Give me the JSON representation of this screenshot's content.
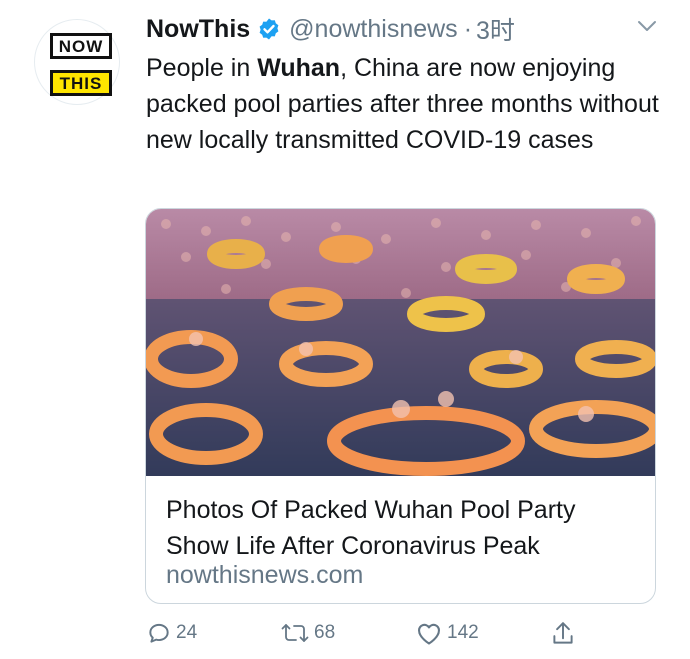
{
  "author": {
    "display_name": "NowThis",
    "handle": "@nowthisnews",
    "separator": "·",
    "time": "3时",
    "logo_top": "NOW",
    "logo_bottom": "THIS"
  },
  "tweet": {
    "text_before": "People in ",
    "text_bold": "Wuhan",
    "text_after": ", China are now enjoying packed pool parties after three months without new locally transmitted COVID-19 cases"
  },
  "card": {
    "title_line1": "Photos Of Packed Wuhan Pool Party",
    "title_line2": "Show Life After Coronavirus Peak",
    "domain": "nowthisnews.com"
  },
  "actions": {
    "reply_count": "24",
    "retweet_count": "68",
    "like_count": "142"
  },
  "colors": {
    "verified": "#1da1f2",
    "secondary_text": "#657786",
    "primary_text": "#14171a",
    "logo_yellow": "#ffe500",
    "border": "#ccd6dd"
  }
}
